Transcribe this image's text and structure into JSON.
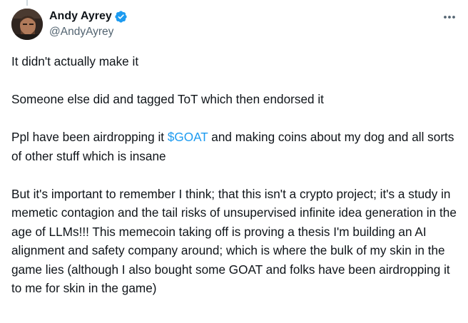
{
  "author": {
    "display_name": "Andy Ayrey",
    "handle": "@AndyAyrey",
    "verified": true
  },
  "tweet": {
    "p1": "It didn't actually make it",
    "p2": "Someone else did and tagged ToT which then endorsed it",
    "p3_before": "Ppl have been airdropping it ",
    "p3_cashtag": "$GOAT",
    "p3_after": " and making coins about my dog and all sorts of other stuff which is insane",
    "p4": "But it's important to remember I think; that this isn't a crypto project; it's a study in memetic contagion and the tail risks of unsupervised infinite idea generation in the age of LLMs!!! This memecoin taking off is proving a thesis I'm building an AI alignment and safety company around; which is where the bulk of my skin in the game lies (although I also bought some GOAT and folks have been airdropping it to me for skin in the game)"
  },
  "icons": {
    "verified": "verified-badge-icon",
    "more": "more-options-icon"
  },
  "colors": {
    "text": "#0f1419",
    "secondary": "#536471",
    "link": "#1d9bf0",
    "verified": "#1d9bf0"
  }
}
